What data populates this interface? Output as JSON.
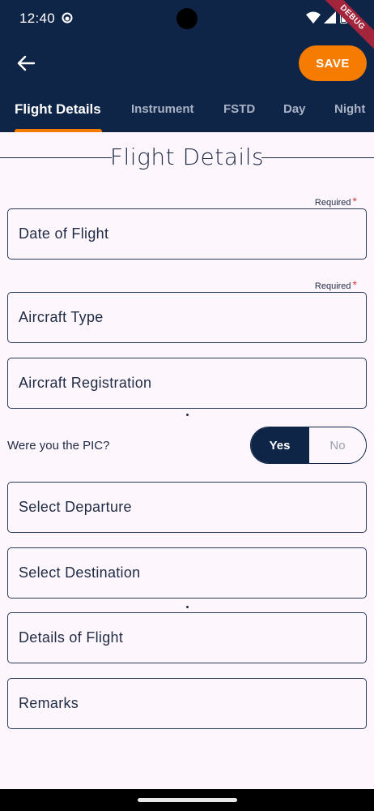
{
  "status_bar": {
    "time": "12:40"
  },
  "debug_banner": "DEBUG",
  "header": {
    "save_label": "SAVE",
    "tabs": [
      {
        "label": "Flight Details",
        "active": true
      },
      {
        "label": "Instrument",
        "active": false
      },
      {
        "label": "FSTD",
        "active": false
      },
      {
        "label": "Day",
        "active": false
      },
      {
        "label": "Night",
        "active": false
      }
    ]
  },
  "form": {
    "section_title": "Flight Details",
    "required_text": "Required",
    "required_marker": "*",
    "fields": {
      "date_of_flight": "Date of Flight",
      "aircraft_type": "Aircraft Type",
      "aircraft_registration": "Aircraft Registration",
      "select_departure": "Select Departure",
      "select_destination": "Select Destination",
      "details_of_flight": "Details of Flight",
      "remarks": "Remarks"
    },
    "pic_question": "Were you the PIC?",
    "pic_toggle": {
      "yes_label": "Yes",
      "no_label": "No",
      "selected": "Yes"
    }
  },
  "colors": {
    "header_bg": "#0f2547",
    "accent": "#f57c00",
    "required_star": "#d93b3b",
    "page_bg": "#fdf7fd"
  },
  "icons": [
    "back-arrow-icon",
    "wifi-icon",
    "signal-icon",
    "battery-icon",
    "dnd-icon"
  ]
}
